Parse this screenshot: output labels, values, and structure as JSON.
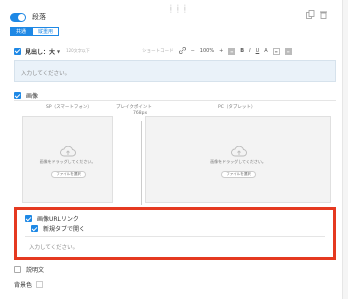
{
  "block": {
    "title": "段落",
    "enabled": true
  },
  "tabs": [
    {
      "label": "共通",
      "active": true
    },
    {
      "label": "縦重用",
      "active": false
    }
  ],
  "heading": {
    "checkbox_checked": true,
    "label": "見出し：大",
    "input_placeholder": "120文字以下",
    "shortcode_label": "ショートコード",
    "zoom": "100%",
    "toolbar": {
      "minus": "−",
      "plus": "+",
      "bold": "B",
      "italic": "I",
      "underline": "U",
      "strike": "A"
    }
  },
  "body_text": {
    "placeholder": "入力してください。"
  },
  "image": {
    "checkbox_checked": true,
    "label": "画像",
    "sp_label": "SP（スマートフォン）",
    "breakpoint_label": "ブレイクポイント",
    "breakpoint_value": "768px",
    "pc_label": "PC（タブレット）",
    "drop_text": "画像をドラッグしてください。",
    "file_button": "ファイルを選択"
  },
  "image_link": {
    "checkbox_checked": true,
    "label": "画像URLリンク",
    "new_tab_checked": true,
    "new_tab_label": "新規タブで開く",
    "url_placeholder": "入力してください。"
  },
  "description": {
    "checkbox_checked": false,
    "label": "説明文"
  },
  "background": {
    "label": "背景色"
  },
  "colors": {
    "accent": "#1e88e5",
    "highlight": "#e53920"
  },
  "icons": [
    "drag-handle-icon",
    "copy-icon",
    "trash-icon",
    "link-icon",
    "cloud-upload-icon"
  ]
}
